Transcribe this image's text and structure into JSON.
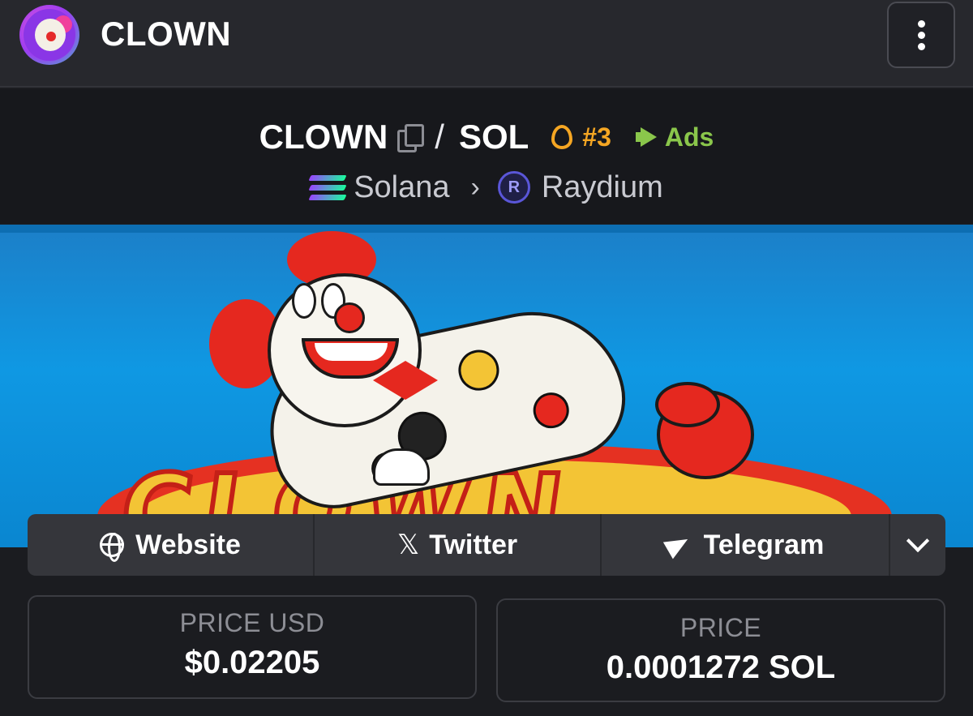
{
  "header": {
    "title": "CLOWN",
    "menu_icon": "more-vertical-icon"
  },
  "pair": {
    "base": "CLOWN",
    "separator": "/",
    "quote": "SOL",
    "rank": "#3",
    "ads": "Ads",
    "chain": "Solana",
    "dex": "Raydium",
    "dex_icon_letter": "R"
  },
  "banner": {
    "text": "CLOWN"
  },
  "links": {
    "website": "Website",
    "twitter": "Twitter",
    "telegram": "Telegram"
  },
  "stats": {
    "price_usd_label": "PRICE USD",
    "price_usd_value": "$0.02205",
    "price_label": "PRICE",
    "price_value": "0.0001272 SOL"
  },
  "colors": {
    "rank": "#f5a623",
    "ads": "#8ac64b",
    "background": "#1b1c20"
  }
}
